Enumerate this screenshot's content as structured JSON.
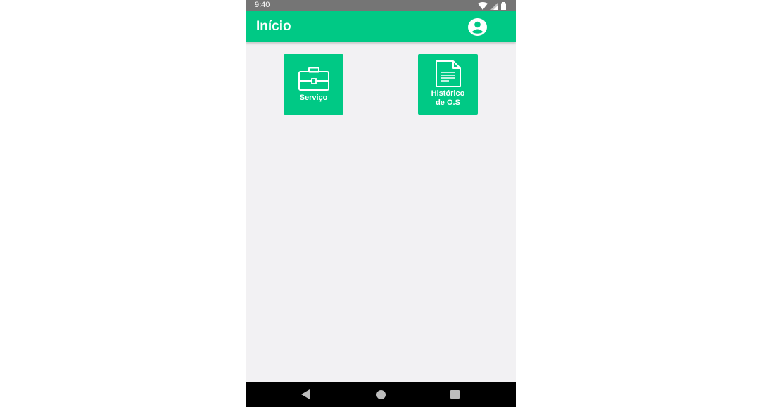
{
  "status_bar": {
    "time": "9:40",
    "icons": [
      "wifi-icon",
      "signal-icon",
      "battery-icon"
    ]
  },
  "app_bar": {
    "title": "Início",
    "account_icon": "account-circle-icon"
  },
  "tiles": [
    {
      "label": "Serviço",
      "icon": "briefcase-icon"
    },
    {
      "label_line1": "Histórico",
      "label_line2": "de O.S",
      "icon": "document-icon"
    }
  ],
  "nav_bar": {
    "buttons": [
      "back-icon",
      "home-icon",
      "recents-icon"
    ]
  },
  "colors": {
    "accent": "#00c985",
    "status_bar": "#757575",
    "background": "#f2f1f3",
    "nav_bar": "#000000"
  }
}
